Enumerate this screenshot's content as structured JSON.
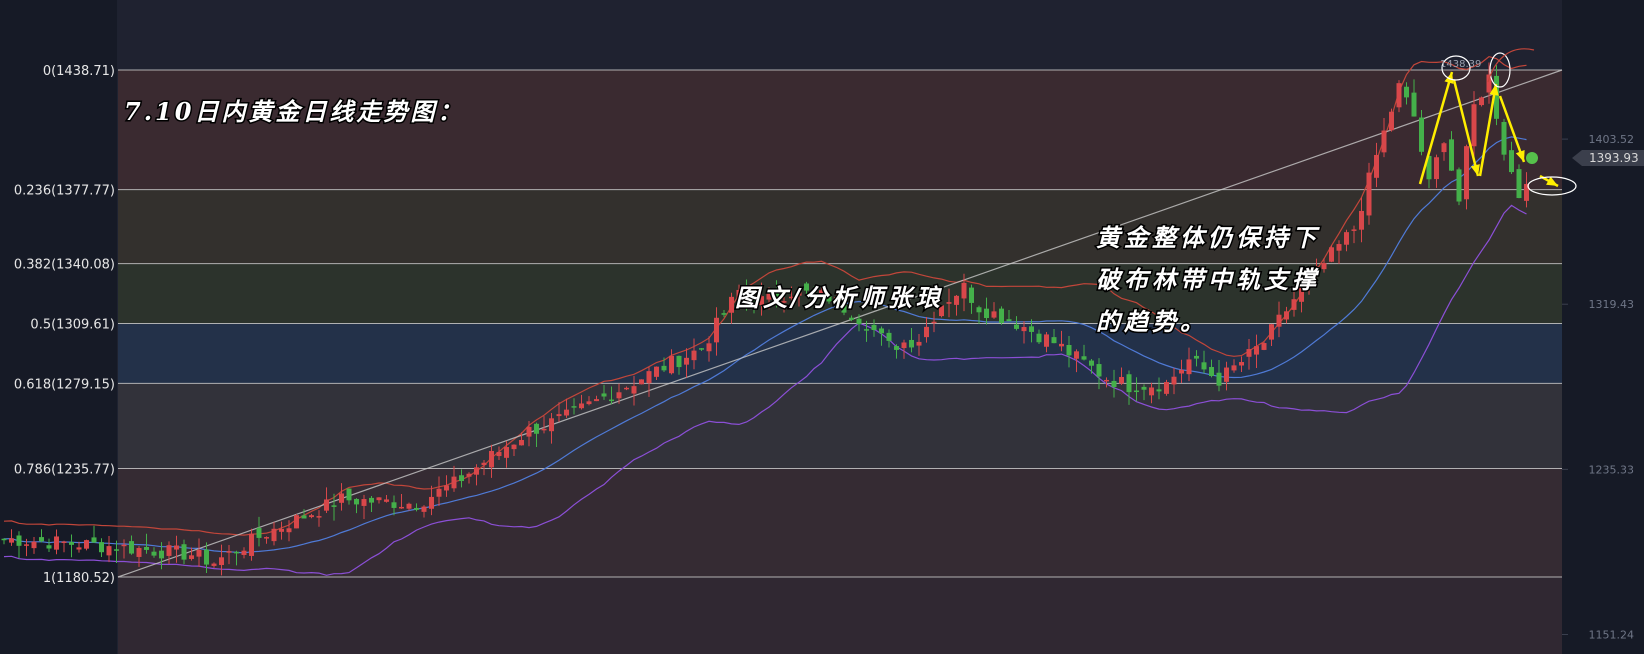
{
  "chart_data": {
    "type": "candlestick",
    "title": "7.10日内黄金日线走势图：",
    "annotations": {
      "author": "图文/分析师张琅",
      "analysis_lines": [
        "黄金整体仍保持下",
        "破布林带中轨支撑",
        "的趋势。"
      ]
    },
    "ylim": [
      1140,
      1460
    ],
    "fib_levels": [
      {
        "label": "0(1438.71)",
        "ratio": 0,
        "price": 1438.71,
        "band_color": "#3a2a30"
      },
      {
        "label": "0.236(1377.77)",
        "ratio": 0.236,
        "price": 1377.77,
        "band_color": "#33302d"
      },
      {
        "label": "0.382(1340.08)",
        "ratio": 0.382,
        "price": 1340.08,
        "band_color": "#2c332c"
      },
      {
        "label": "0.5(1309.61)",
        "ratio": 0.5,
        "price": 1309.61,
        "band_color": "#233149"
      },
      {
        "label": "0.618(1279.15)",
        "ratio": 0.618,
        "price": 1279.15,
        "band_color": "#32323a"
      },
      {
        "label": "0.786(1235.77)",
        "ratio": 0.786,
        "price": 1235.77,
        "band_color": "#352b33"
      },
      {
        "label": "1(1180.52)",
        "ratio": 1,
        "price": 1180.52,
        "band_color": "#302832"
      }
    ],
    "price_axis_ticks": [
      "1403.52",
      "1319.43",
      "1235.33",
      "1151.24"
    ],
    "price_axis_values": [
      1403.52,
      1319.43,
      1235.33,
      1151.24
    ],
    "current_price": {
      "label": "1393.93",
      "value": 1393.93
    },
    "peak_label": "1438.39",
    "colors": {
      "up": "#d8474a",
      "down": "#44b04a",
      "boll_upper": "#c2463a",
      "boll_mid": "#4f7ad6",
      "boll_lower": "#8b4fd6",
      "trendline": "#c9c9c9",
      "arrow": "#ffee00",
      "fib_line": "#c8c8c8"
    },
    "candle_count": 190,
    "waypoints": [
      [
        0,
        1200
      ],
      [
        15,
        1196
      ],
      [
        25,
        1192
      ],
      [
        28,
        1188
      ],
      [
        35,
        1203
      ],
      [
        45,
        1220
      ],
      [
        55,
        1218
      ],
      [
        60,
        1228
      ],
      [
        65,
        1242
      ],
      [
        70,
        1255
      ],
      [
        75,
        1262
      ],
      [
        85,
        1282
      ],
      [
        93,
        1297
      ],
      [
        98,
        1326
      ],
      [
        100,
        1320
      ],
      [
        105,
        1326
      ],
      [
        110,
        1323
      ],
      [
        115,
        1310
      ],
      [
        118,
        1298
      ],
      [
        122,
        1302
      ],
      [
        125,
        1320
      ],
      [
        128,
        1328
      ],
      [
        130,
        1318
      ],
      [
        135,
        1310
      ],
      [
        140,
        1300
      ],
      [
        143,
        1292
      ],
      [
        147,
        1282
      ],
      [
        150,
        1278
      ],
      [
        155,
        1279
      ],
      [
        158,
        1291
      ],
      [
        162,
        1281
      ],
      [
        165,
        1290
      ],
      [
        168,
        1300
      ],
      [
        172,
        1322
      ],
      [
        176,
        1340
      ],
      [
        180,
        1358
      ],
      [
        183,
        1395
      ],
      [
        186,
        1430
      ],
      [
        188,
        1415
      ],
      [
        190,
        1380
      ],
      [
        192,
        1405
      ],
      [
        194,
        1372
      ],
      [
        196,
        1420
      ],
      [
        198,
        1435
      ],
      [
        200,
        1398
      ],
      [
        202,
        1375
      ],
      [
        204,
        1394
      ]
    ],
    "boll_upper_series": [
      [
        1195,
        1212
      ],
      [
        1196,
        1212
      ],
      [
        1197,
        1212
      ],
      [
        1198,
        1212
      ],
      [
        1199,
        1212
      ],
      [
        1200,
        1212
      ],
      [
        1201,
        1212
      ],
      [
        1202,
        1212
      ],
      [
        1203,
        1212
      ],
      [
        1204,
        1212
      ],
      [
        1205,
        1212
      ],
      [
        1206,
        1212
      ],
      [
        1207,
        1212
      ]
    ]
  }
}
